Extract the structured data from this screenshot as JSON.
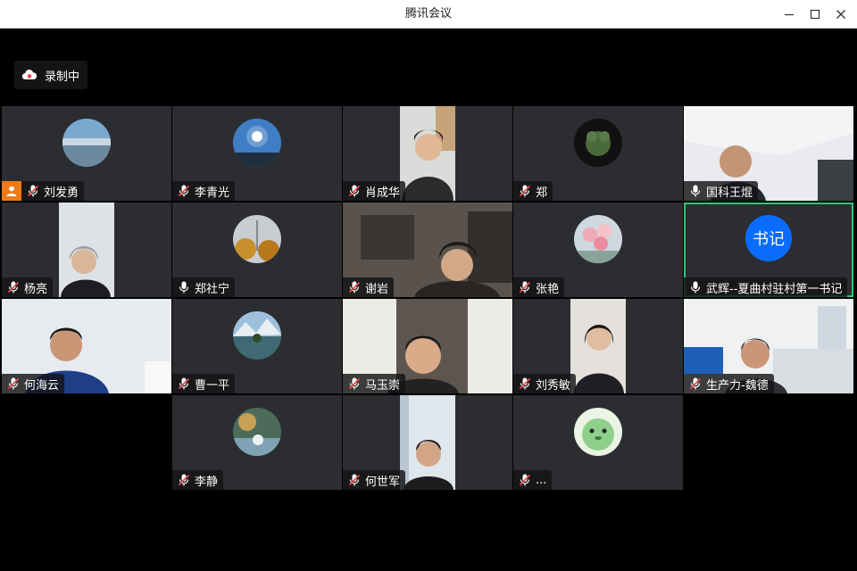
{
  "window": {
    "title": "腾讯会议"
  },
  "recording": {
    "label": "录制中"
  },
  "tiles": [
    {
      "name": "刘发勇",
      "mic": "muted",
      "host": true
    },
    {
      "name": "李青光",
      "mic": "muted"
    },
    {
      "name": "肖成华",
      "mic": "muted"
    },
    {
      "name": "郑",
      "mic": "muted"
    },
    {
      "name": "国科王焜",
      "mic": "on"
    },
    {
      "name": "杨亮",
      "mic": "muted"
    },
    {
      "name": "郑社宁",
      "mic": "on"
    },
    {
      "name": "谢岩",
      "mic": "muted"
    },
    {
      "name": "张艳",
      "mic": "muted"
    },
    {
      "name": "武辉--夏曲村驻村第一书记",
      "mic": "on",
      "initials": "书记",
      "active": true
    },
    {
      "name": "何海云",
      "mic": "muted"
    },
    {
      "name": "曹一平",
      "mic": "muted"
    },
    {
      "name": "马玉崇",
      "mic": "muted"
    },
    {
      "name": "刘秀敏",
      "mic": "muted"
    },
    {
      "name": "生产力-魏德",
      "mic": "muted"
    },
    {
      "name": "李静",
      "mic": "muted"
    },
    {
      "name": "何世军",
      "mic": "muted"
    },
    {
      "name": "...",
      "mic": "muted"
    }
  ],
  "colors": {
    "accent_active": "#2ec57a",
    "host_badge": "#f07a18",
    "initials_avatar": "#0a6cff",
    "mute_red": "#e5484d"
  },
  "icons": {
    "minimize": "minimize-icon",
    "maximize": "maximize-icon",
    "close": "close-icon",
    "record": "cloud-record-icon",
    "mic": "microphone-icon",
    "mic_muted": "microphone-muted-icon",
    "host": "host-person-icon"
  }
}
